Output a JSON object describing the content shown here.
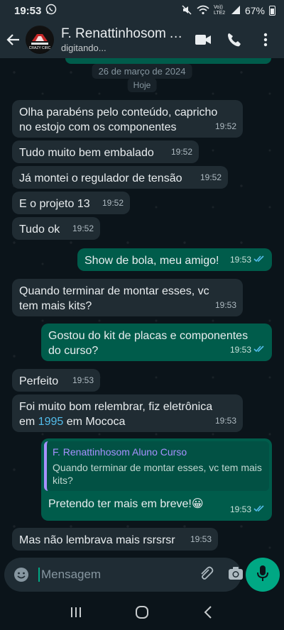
{
  "status_bar": {
    "time": "19:53",
    "battery": "67%",
    "network": "Vo)) LTE2"
  },
  "header": {
    "contact_name": "F. Renattinhosom Al...",
    "status": "digitando...",
    "avatar_text": "CRAZY CIRC"
  },
  "chat": {
    "date_label": "26 de março de 2024",
    "today_label": "Hoje",
    "messages": [
      {
        "dir": "in",
        "text_line1": "Olha parabéns pelo conteúdo, capricho",
        "text_line2": "no estojo com os componentes",
        "time": "19:52"
      },
      {
        "dir": "in",
        "text": "Tudo muito bem embalado",
        "time": "19:52"
      },
      {
        "dir": "in",
        "text": "Já montei o regulador de tensão",
        "time": "19:52"
      },
      {
        "dir": "in",
        "text": "E o projeto 13",
        "time": "19:52"
      },
      {
        "dir": "in",
        "text": "Tudo ok",
        "time": "19:52"
      },
      {
        "dir": "out",
        "text": "Show de bola, meu amigo!",
        "time": "19:53"
      },
      {
        "dir": "in",
        "text_line1": "Quando terminar de montar esses, vc",
        "text_line2": "tem mais kits?",
        "time": "19:53"
      },
      {
        "dir": "out",
        "text_line1": "Gostou do kit de placas e componentes",
        "text_line2": "do curso?",
        "time": "19:53"
      },
      {
        "dir": "in",
        "text": "Perfeito",
        "time": "19:53"
      },
      {
        "dir": "in",
        "text_line1": "Foi muito bom relembrar, fiz eletrônica",
        "text_line2_before": "em ",
        "text_line2_link": "1995",
        "text_line2_after": " em Mococa",
        "time": "19:53"
      },
      {
        "dir": "out",
        "quote_name": "F. Renattinhosom Aluno Curso",
        "quote_text": "Quando terminar de montar esses, vc tem mais kits?",
        "text": "Pretendo ter mais em breve!",
        "emoji": "😀",
        "time": "19:53"
      },
      {
        "dir": "in",
        "text": "Mas não lembrava mais rsrsrsr",
        "time": "19:53"
      }
    ]
  },
  "composer": {
    "placeholder": "Mensagem"
  },
  "colors": {
    "incoming_bubble": "#202c33",
    "outgoing_bubble": "#005c4b",
    "accent": "#00a884",
    "read_ticks": "#53bdeb"
  },
  "icons": [
    "back-arrow-icon",
    "video-call-icon",
    "phone-icon",
    "more-vert-icon",
    "emoji-icon",
    "attach-icon",
    "camera-icon",
    "mic-icon",
    "recents-icon",
    "home-icon",
    "back-icon",
    "whatsapp-status-icon",
    "mute-icon",
    "wifi-icon",
    "signal-icon",
    "battery-icon"
  ]
}
